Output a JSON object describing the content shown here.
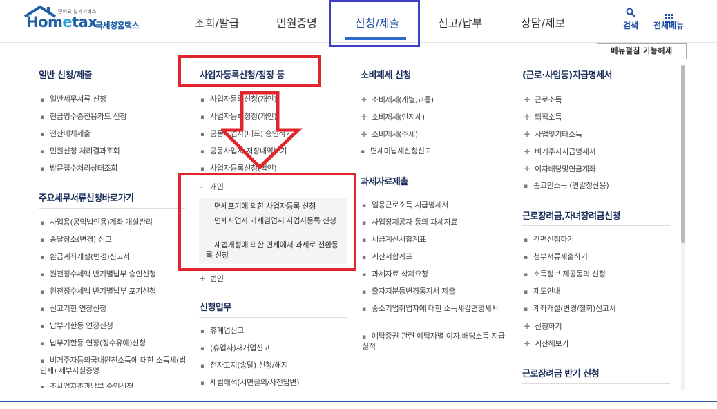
{
  "logo": {
    "tagline": "믿어요 납세서비스",
    "word_home": "Hom",
    "word_e": "e",
    "word_tax": "tax",
    "subtitle": "국세청홈택스"
  },
  "topnav": {
    "items": [
      "조회/발급",
      "민원증명",
      "신청/제출",
      "신고/납부",
      "상담/제보"
    ],
    "active": "신청/제출"
  },
  "tools": {
    "search_label": "검색",
    "allmenu_label": "전체메뉴"
  },
  "menu_toggle_label": "메뉴펼침 기능해제",
  "col1": {
    "title1": "일반 신청/제출",
    "items1": [
      "일반세무서류 신청",
      "현금영수증전용카드 신청",
      "전산매체제출",
      "민원신청 처리결과조회",
      "방문접수처리상태조회"
    ],
    "title2": "주요세무서류신청바로가기",
    "items2": [
      "사업용(공익법인용)계좌 개설관리",
      "송달장소(변경) 신고",
      "환급계좌개설(변경)신고서",
      "원천징수세액 반기별납부 승인신청",
      "원천징수세액 반기별납부 포기신청",
      "신고기한 연장신청",
      "납부기한등 연장신청",
      "납부기한등 연장(징수유예)신청",
      "비거주자등의국내원천소득에 대한 소득세(법인세) 세부사실증명",
      "조사업자초과납부 승인신청"
    ]
  },
  "col2": {
    "title1": "사업자등록신청/정정 등",
    "items1": [
      "사업자등록신청(개인)",
      "사업자등록정정(개인)",
      "공동사업자(대표) 승인하기",
      "공동사업자 저장내역보기",
      "사업자등록신청(법인)"
    ],
    "expanded_label": "개인",
    "sub_items": [
      "면세포기에 의한 사업자등록 신청",
      "면세사업자 과세겸업시 사업자등록 신청",
      "세법개정에 의한 면세에서 과세로 전환등록 신청"
    ],
    "corp_label": "법인",
    "title2": "신청업무",
    "items2": [
      "휴폐업신고",
      "(휴업자)재개업신고",
      "전자고지(송달) 신청/해지",
      "세법해석(서면질의/사전답변)"
    ]
  },
  "col3": {
    "title1": "소비제세 신청",
    "items1": [
      "소비제세(개별,교통)",
      "소비제세(인지세)",
      "소비제세(주세)",
      "면세미납세신청신고"
    ],
    "title2": "과세자료제출",
    "items2": [
      "일용근로소득 지급명세서",
      "사업장제공자 등의 과세자료",
      "세금계산서합계표",
      "계산서합계표",
      "과세자료 삭제요청",
      "출자지분등변경통지서 제출",
      "중소기업취업자에 대한 소득세감면명세서",
      "예탁증권 관련 예탁자별 이자,배당소득 지급 실적"
    ]
  },
  "col4": {
    "title1": "(근로·사업등)지급명세서",
    "items1": [
      "근로소득",
      "퇴직소득",
      "사업및기타소득",
      "비거주자지급명세서",
      "이자배당및연금계좌",
      "종교인소득 (연말정산용)"
    ],
    "title2": "근로장려금,자녀장려금신청",
    "items2": [
      "간편신청하기",
      "첨부서류제출하기",
      "소득정보 제공동의 신청",
      "제도안내",
      "계좌개설(변경/철회)신고서",
      "신청하기",
      "계산해보기"
    ],
    "title3": "근로장려금 반기 신청"
  },
  "colors": {
    "brand": "#1d5fa6",
    "annotation_red": "#e0262c",
    "annotation_blue": "#3d3dc7"
  }
}
